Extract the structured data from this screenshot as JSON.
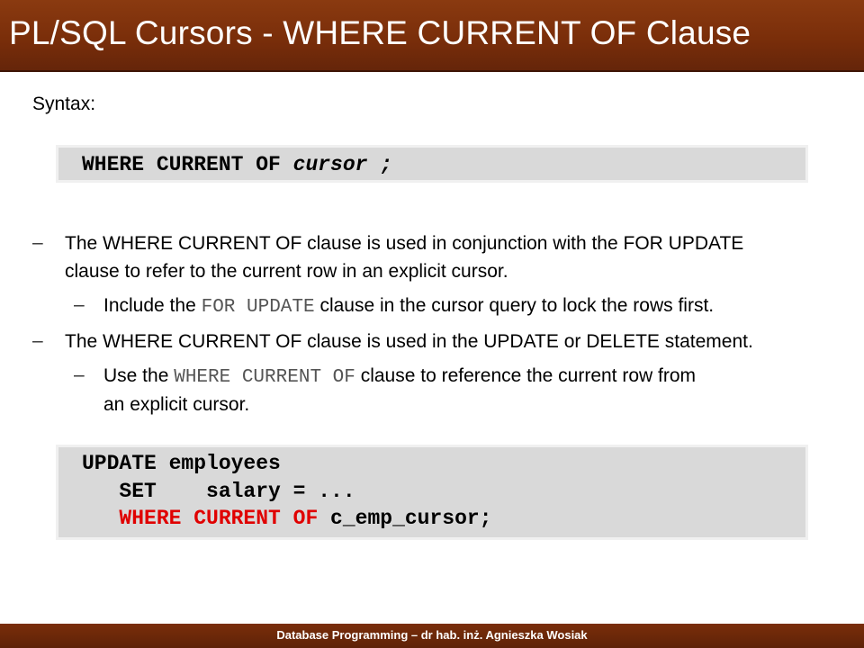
{
  "slide": {
    "title": "PL/SQL Cursors - WHERE CURRENT OF Clause",
    "syntax_label": "Syntax:",
    "syntax_box": {
      "keyword": "WHERE CURRENT OF ",
      "italic": "cursor ;"
    },
    "bullets": [
      {
        "dash": "–",
        "line1": "The WHERE CURRENT OF clause is used in conjunction with the FOR UPDATE",
        "line2": "clause to refer to the current row in an explicit cursor."
      },
      {
        "dash": "–",
        "pre": "Include the ",
        "code": "FOR UPDATE",
        "post": " clause in the cursor query to lock the rows first."
      },
      {
        "dash": "–",
        "line1": "The WHERE CURRENT OF clause is used in the UPDATE or DELETE statement."
      },
      {
        "dash": "–",
        "pre": "Use the ",
        "code": "WHERE CURRENT OF",
        "post": " clause to reference the current row from",
        "line2": "an explicit cursor."
      }
    ],
    "code_example": {
      "line1": "UPDATE employees",
      "line2": "   SET    salary = ...",
      "line3_red": "   WHERE CURRENT OF",
      "line3_rest": " c_emp_cursor;"
    },
    "footer": "Database Programming – dr hab. inż. Agnieszka Wosiak",
    "colors": {
      "title_bar": "#7a2e0a",
      "highlight": "#e00000",
      "code_bg": "#d9d9d9"
    }
  }
}
